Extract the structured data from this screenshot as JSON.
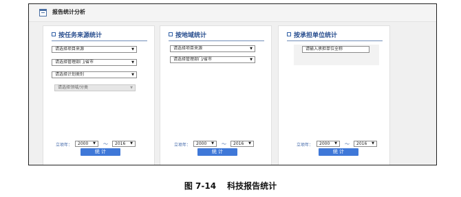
{
  "window": {
    "title": "报告统计分析",
    "icon": "calendar-icon"
  },
  "panels": [
    {
      "title": "按任务来源统计",
      "selects": [
        {
          "value": "请选择项目来源",
          "disabled": false
        },
        {
          "value": "请选择管理部门/省市",
          "disabled": false
        },
        {
          "value": "请选择计划类别",
          "disabled": false
        },
        {
          "value": "请选择领域/分类",
          "disabled": true
        }
      ],
      "year_label": "立项年：",
      "year_from": "2000",
      "tilde": "～",
      "year_to": "2016",
      "button": "统 计"
    },
    {
      "title": "按地域统计",
      "selects": [
        {
          "value": "请选择项目来源",
          "disabled": false
        },
        {
          "value": "请选择管理部门/省市",
          "disabled": false
        }
      ],
      "year_label": "立项年：",
      "year_from": "2000",
      "tilde": "～",
      "year_to": "2016",
      "button": "统 计"
    },
    {
      "title": "按承担单位统计",
      "input_value": "请输入承担单位全称",
      "year_label": "立项年：",
      "year_from": "2000",
      "tilde": "～",
      "year_to": "2016",
      "button": "统 计"
    }
  ],
  "caption": {
    "figure": "图 7-14",
    "text": "科技报告统计"
  },
  "colors": {
    "accent": "#3f78d8",
    "heading": "#2a4f8f",
    "label": "#3f66a8"
  }
}
